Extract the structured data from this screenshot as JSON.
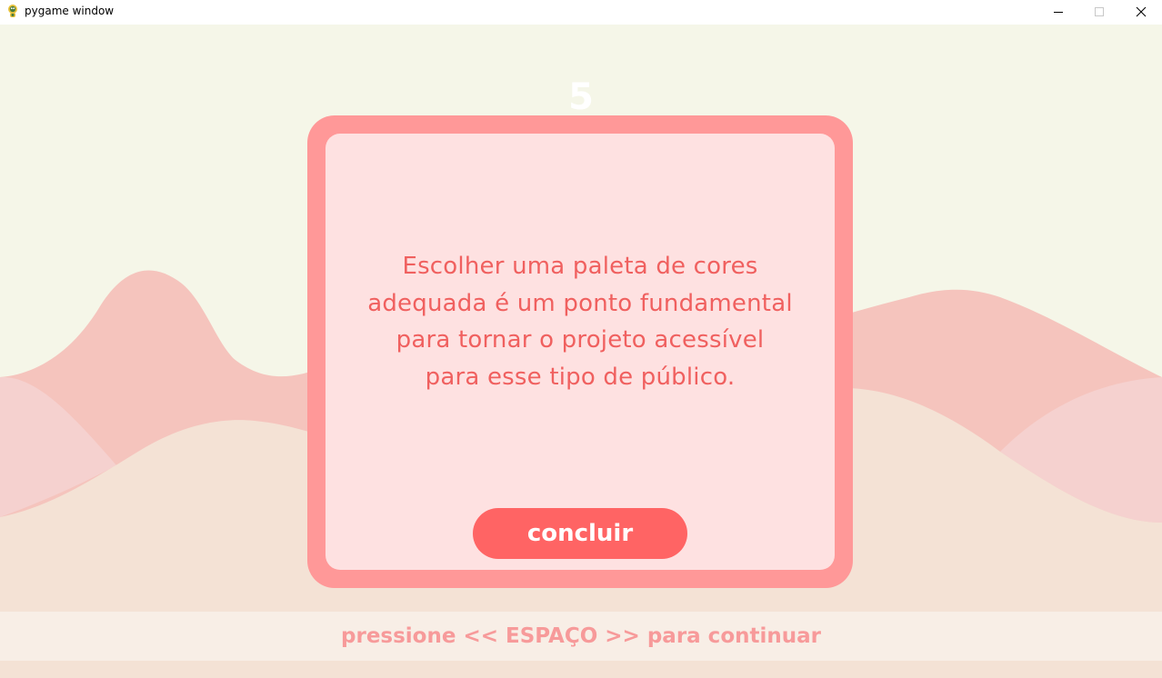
{
  "window": {
    "title": "pygame window",
    "controls": {
      "minimize_icon": "minimize-icon",
      "maximize_icon": "maximize-icon",
      "close_icon": "close-icon"
    }
  },
  "game": {
    "counter": "5",
    "card": {
      "message_lines": [
        "Escolher uma paleta de cores",
        "adequada é um ponto fundamental",
        "para tornar o projeto acessível",
        "para esse tipo de público."
      ],
      "button_label": "concluir"
    },
    "hint": "pressione << ESPAÇO >> para continuar"
  },
  "colors": {
    "sky": "#f5f6e8",
    "hill_back": "#f5c4bd",
    "hill_mid": "#f5d1cf",
    "hill_front": "#f4e2d5",
    "card_border": "#ff9898",
    "card_fill": "#fee1e1",
    "message_text": "#f0605f",
    "button": "#ff6464",
    "hint_bar": "#f8eee6",
    "hint_text": "#f79a9a"
  }
}
